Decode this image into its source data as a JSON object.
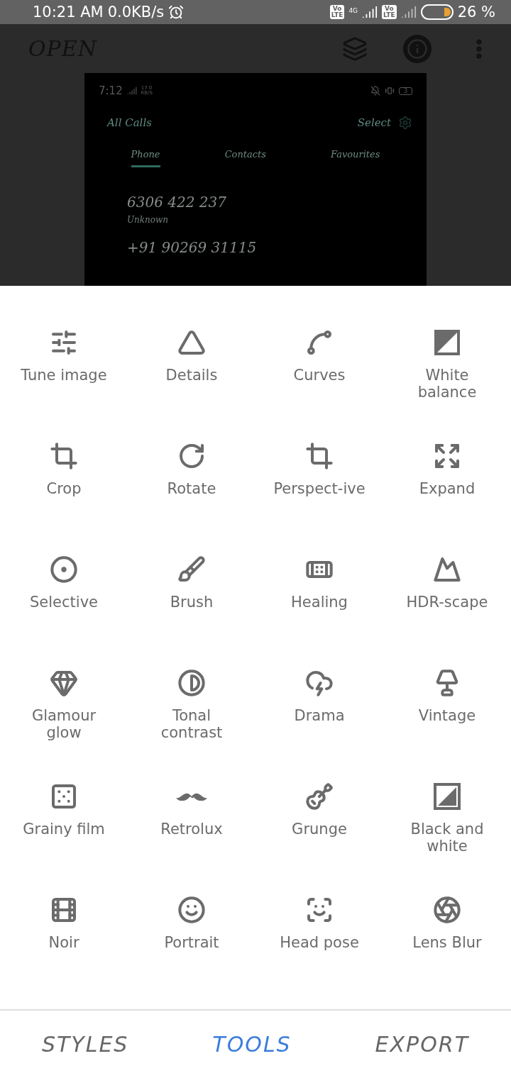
{
  "status_bar": {
    "time": "10:21 AM",
    "speed": "0.0KB/s",
    "network": "4G",
    "volte": [
      [
        "Vo",
        "LTE"
      ],
      [
        "Vo",
        "LTE"
      ]
    ],
    "battery": "26 %"
  },
  "toolbar": {
    "title": "OPEN"
  },
  "preview": {
    "status_time": "7:12",
    "status_speed": [
      "17.0",
      "KB/S"
    ],
    "filter": "All Calls",
    "select": "Select",
    "battery": "3",
    "tabs": [
      {
        "label": "Phone",
        "selected": true
      },
      {
        "label": "Contacts",
        "selected": false
      },
      {
        "label": "Favourites",
        "selected": false
      }
    ],
    "calls": [
      {
        "number": "6306 422 237",
        "sub": "Unknown"
      },
      {
        "number": "+91 90269 31115"
      }
    ]
  },
  "tools": [
    {
      "label": "Tune image"
    },
    {
      "label": "Details"
    },
    {
      "label": "Curves"
    },
    {
      "label": "White balance"
    },
    {
      "label": "Crop"
    },
    {
      "label": "Rotate"
    },
    {
      "label": "Perspect-ive"
    },
    {
      "label": "Expand"
    },
    {
      "label": "Selective"
    },
    {
      "label": "Brush"
    },
    {
      "label": "Healing"
    },
    {
      "label": "HDR-scape"
    },
    {
      "label": "Glamour glow"
    },
    {
      "label": "Tonal contrast"
    },
    {
      "label": "Drama"
    },
    {
      "label": "Vintage"
    },
    {
      "label": "Grainy film"
    },
    {
      "label": "Retrolux"
    },
    {
      "label": "Grunge"
    },
    {
      "label": "Black and white"
    },
    {
      "label": "Noir"
    },
    {
      "label": "Portrait"
    },
    {
      "label": "Head pose"
    },
    {
      "label": "Lens Blur"
    }
  ],
  "bottom_tabs": [
    {
      "label": "STYLES",
      "selected": false
    },
    {
      "label": "TOOLS",
      "selected": true
    },
    {
      "label": "EXPORT",
      "selected": false
    }
  ]
}
